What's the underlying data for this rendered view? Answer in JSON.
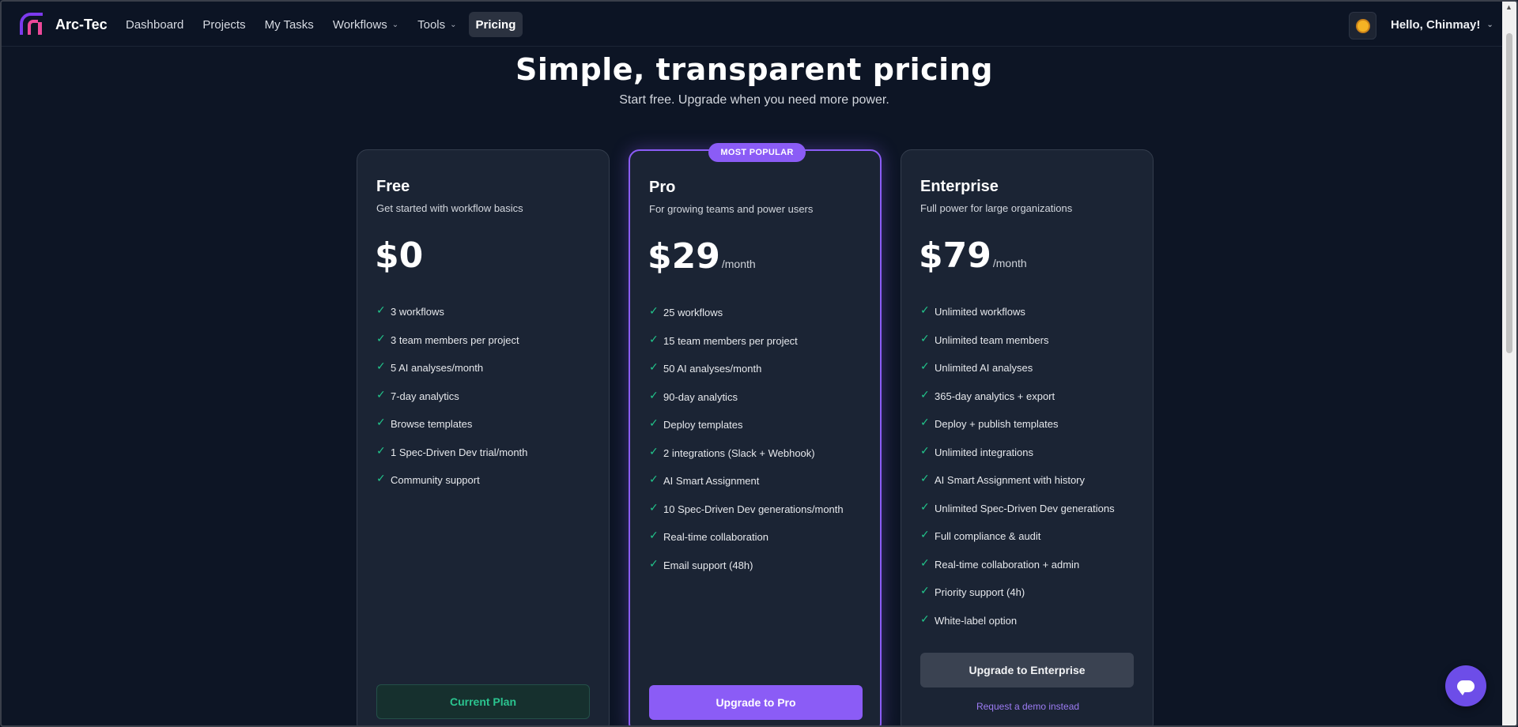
{
  "nav": {
    "brand": "Arc-Tec",
    "links": [
      {
        "label": "Dashboard"
      },
      {
        "label": "Projects"
      },
      {
        "label": "My Tasks"
      },
      {
        "label": "Workflows",
        "dropdown": true
      },
      {
        "label": "Tools",
        "dropdown": true
      },
      {
        "label": "Pricing",
        "active": true
      }
    ],
    "theme_icon": "sun-icon",
    "user_greeting": "Hello, Chinmay!"
  },
  "hero": {
    "title": "Simple, transparent pricing",
    "subtitle": "Start free. Upgrade when you need more power."
  },
  "plans": {
    "free": {
      "name": "Free",
      "description": "Get started with workflow basics",
      "price": "$0",
      "features": [
        "3 workflows",
        "3 team members per project",
        "5 AI analyses/month",
        "7-day analytics",
        "Browse templates",
        "1 Spec-Driven Dev trial/month",
        "Community support"
      ],
      "button": "Current Plan"
    },
    "pro": {
      "badge": "MOST POPULAR",
      "name": "Pro",
      "description": "For growing teams and power users",
      "price": "$29",
      "period": "/month",
      "features": [
        "25 workflows",
        "15 team members per project",
        "50 AI analyses/month",
        "90-day analytics",
        "Deploy templates",
        "2 integrations (Slack + Webhook)",
        "AI Smart Assignment",
        "10 Spec-Driven Dev generations/month",
        "Real-time collaboration",
        "Email support (48h)"
      ],
      "button": "Upgrade to Pro"
    },
    "enterprise": {
      "name": "Enterprise",
      "description": "Full power for large organizations",
      "price": "$79",
      "period": "/month",
      "features": [
        "Unlimited workflows",
        "Unlimited team members",
        "Unlimited AI analyses",
        "365-day analytics + export",
        "Deploy + publish templates",
        "Unlimited integrations",
        "AI Smart Assignment with history",
        "Unlimited Spec-Driven Dev generations",
        "Full compliance & audit",
        "Real-time collaboration + admin",
        "Priority support (4h)",
        "White-label option"
      ],
      "button": "Upgrade to Enterprise",
      "secondary_link": "Request a demo instead"
    }
  },
  "colors": {
    "accent": "#8b5cf6",
    "check": "#22c58b",
    "background": "#0d1525",
    "card": "#1b2434"
  },
  "chat_icon": "chat-bubble-icon"
}
